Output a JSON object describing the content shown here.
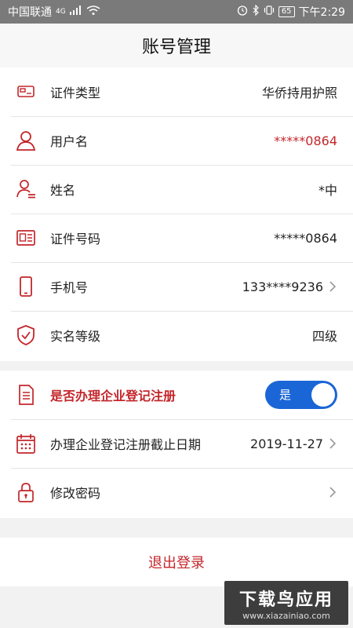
{
  "status_bar": {
    "carrier": "中国联通",
    "network": "4G",
    "battery": "65",
    "time": "下午2:29"
  },
  "header": {
    "title": "账号管理"
  },
  "account_rows": [
    {
      "icon": "id-card-icon",
      "label": "证件类型",
      "value": "华侨持用护照"
    },
    {
      "icon": "user-icon",
      "label": "用户名",
      "value": "*****0864"
    },
    {
      "icon": "person-name-icon",
      "label": "姓名",
      "value": "*中"
    },
    {
      "icon": "id-number-icon",
      "label": "证件号码",
      "value": "*****0864"
    },
    {
      "icon": "phone-icon",
      "label": "手机号",
      "value": "133****9236"
    },
    {
      "icon": "shield-check-icon",
      "label": "实名等级",
      "value": "四级"
    }
  ],
  "enterprise": {
    "register_label": "是否办理企业登记注册",
    "toggle_label": "是",
    "toggle_on": true,
    "deadline_label": "办理企业登记注册截止日期",
    "deadline_value": "2019-11-27",
    "password_label": "修改密码"
  },
  "logout_label": "退出登录",
  "watermark": {
    "line1": "下载鸟应用",
    "line2": "www.xiazainiao.com"
  },
  "colors": {
    "accent": "#c3262b",
    "toggle": "#1a66d6"
  }
}
